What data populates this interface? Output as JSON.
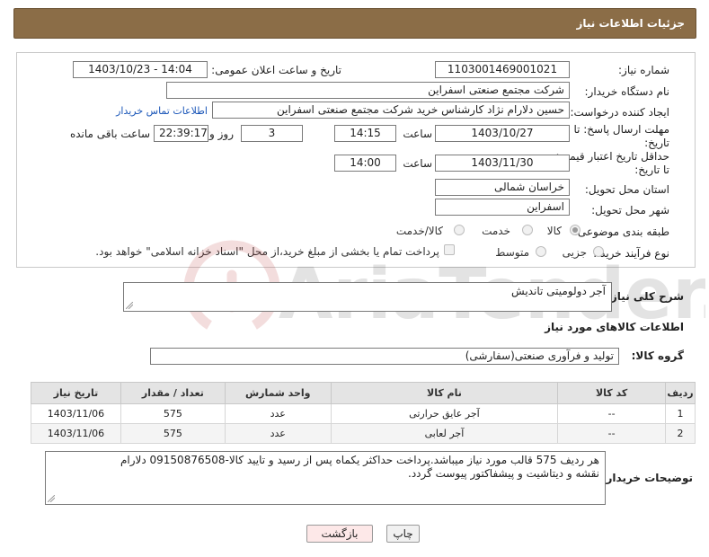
{
  "header": {
    "title": "جزئیات اطلاعات نیاز"
  },
  "form": {
    "need_number_label": "شماره نیاز:",
    "need_number": "1103001469001021",
    "announce_label": "تاریخ و ساعت اعلان عمومی:",
    "announce_value": "1403/10/23 - 14:04",
    "buyer_org_label": "نام دستگاه خریدار:",
    "buyer_org": "شرکت مجتمع صنعتی اسفراین",
    "creator_label": "ایجاد کننده درخواست:",
    "creator": "حسین دلارام نژاد کارشناس خرید شرکت مجتمع صنعتی اسفراین",
    "contact_link": "اطلاعات تماس خریدار",
    "deadline_label": "مهلت ارسال پاسخ: تا تاریخ:",
    "deadline_date": "1403/10/27",
    "hour_label": "ساعت",
    "deadline_time": "14:15",
    "days_value": "3",
    "days_label": "روز و",
    "remaining_time": "22:39:17",
    "remaining_label": "ساعت باقی مانده",
    "validity_label": "حداقل تاریخ اعتبار قیمت: تا تاریخ:",
    "validity_date": "1403/11/30",
    "validity_time": "14:00",
    "province_label": "استان محل تحویل:",
    "province": "خراسان شمالی",
    "city_label": "شهر محل تحویل:",
    "city": "اسفراین",
    "category_label": "طبقه بندی موضوعی:",
    "category_options": [
      "کالا",
      "خدمت",
      "کالا/خدمت"
    ],
    "process_label": "نوع فرآیند خرید :",
    "process_options": [
      "جزیی",
      "متوسط"
    ],
    "payment_note": "پرداخت تمام یا بخشی از مبلغ خرید،از محل \"اسناد خزانه اسلامی\" خواهد بود."
  },
  "description": {
    "label": "شرح کلی نیاز:",
    "value": "آجر دولومیتی تاندیش"
  },
  "goods_section": {
    "title": "اطلاعات کالاهای مورد نیاز"
  },
  "goods_group": {
    "label": "گروه کالا:",
    "value": "تولید و فرآوری صنعتی(سفارشی)"
  },
  "table": {
    "headers": [
      "ردیف",
      "کد کالا",
      "نام کالا",
      "واحد شمارش",
      "تعداد / مقدار",
      "تاریخ نیاز"
    ],
    "rows": [
      [
        "1",
        "--",
        "آجر عایق حرارتی",
        "عدد",
        "575",
        "1403/11/06"
      ],
      [
        "2",
        "--",
        "آجر لعابی",
        "عدد",
        "575",
        "1403/11/06"
      ]
    ]
  },
  "buyer_notes": {
    "label": "توضیحات خریدار:",
    "line1": "هر ردیف 575 قالب مورد نیاز میباشد.پرداخت حداکثر یکماه پس از رسید و تایید کالا-09150876508 دلارام",
    "line2": "نقشه و دیتاشیت و پیشفاکتور پیوست گردد."
  },
  "buttons": {
    "print": "چاپ",
    "back": "بازگشت"
  },
  "watermark": {
    "text": "AriaTender.net"
  }
}
